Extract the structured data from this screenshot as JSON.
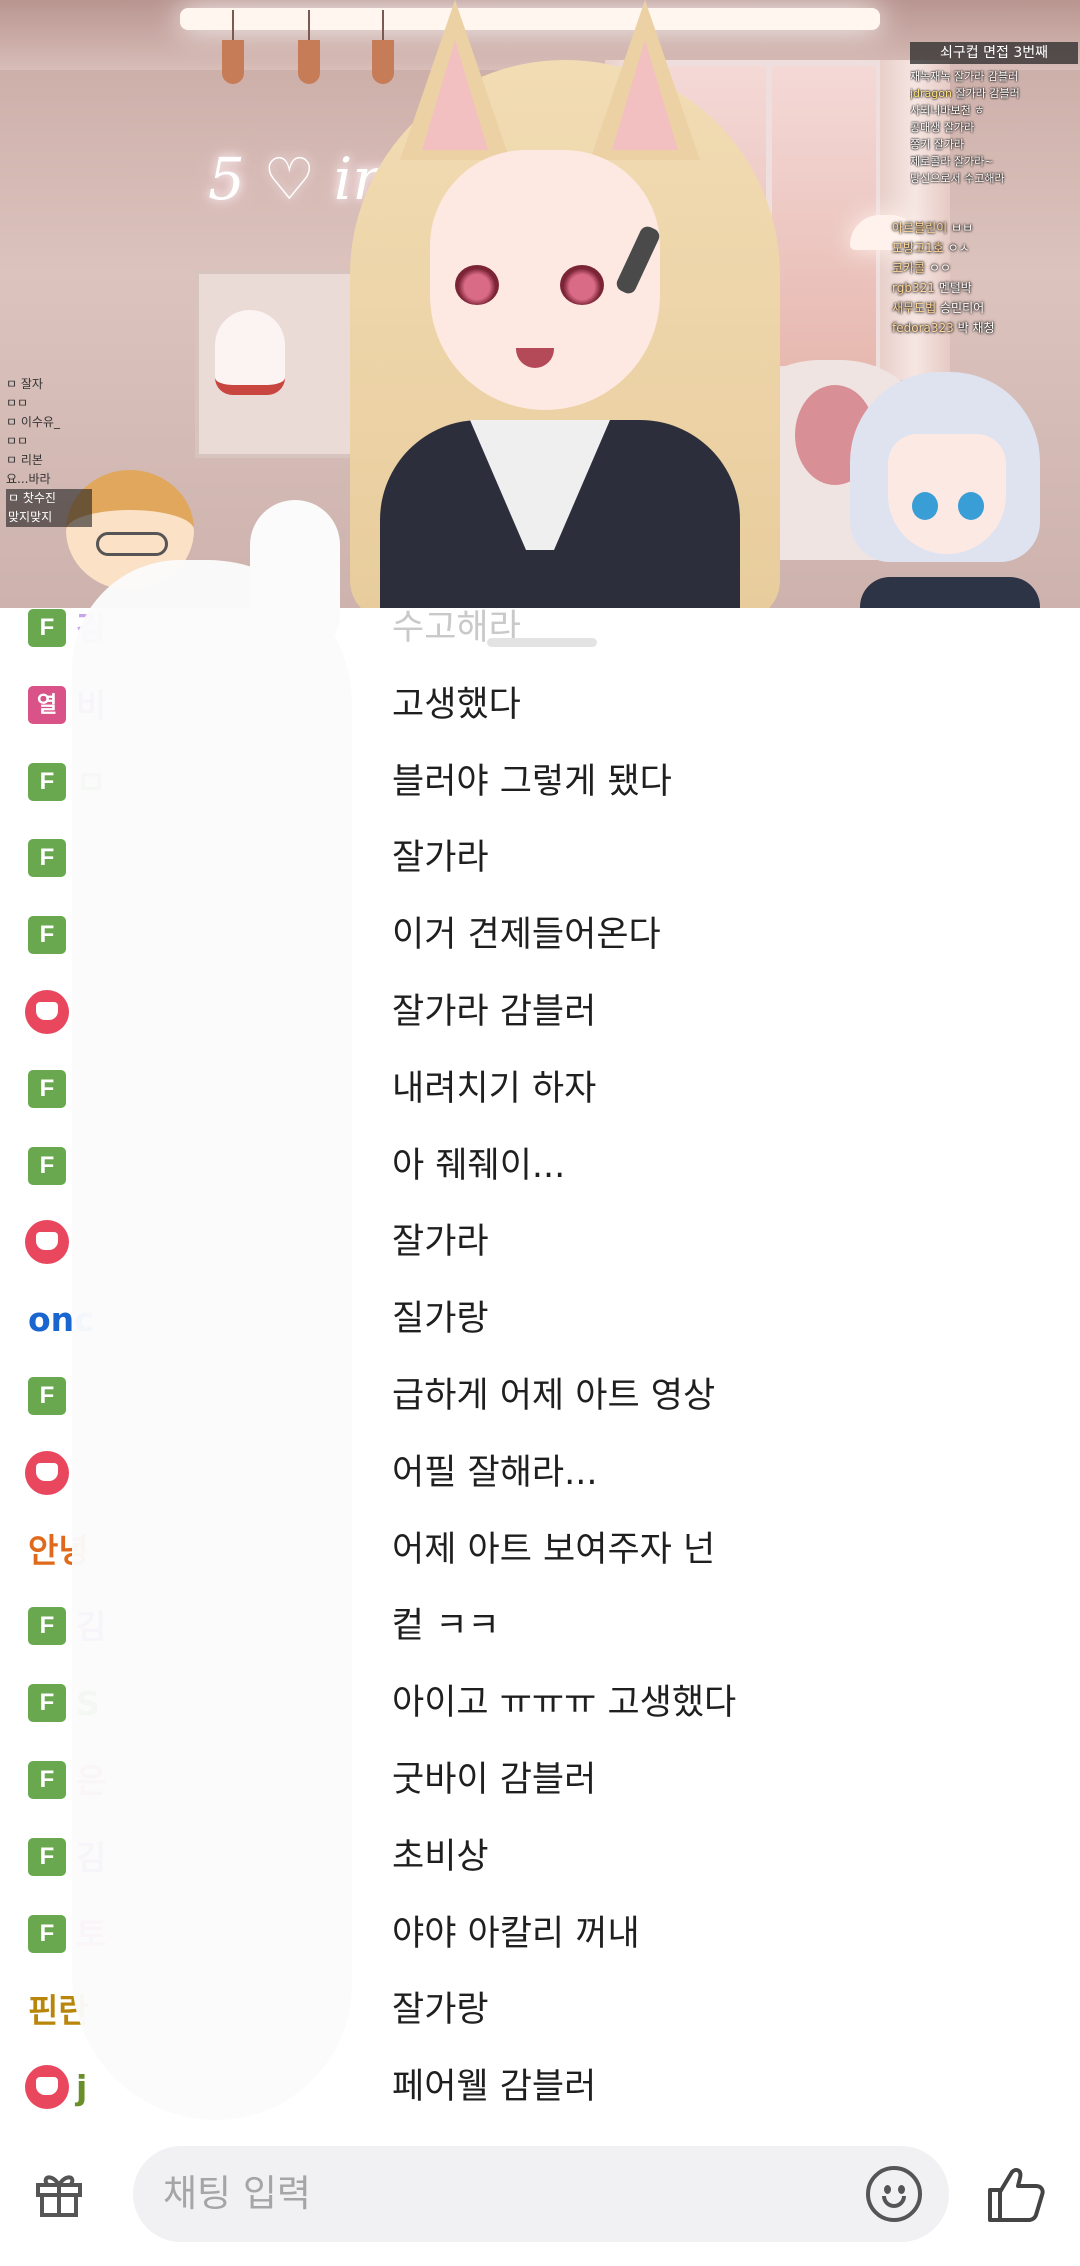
{
  "stream": {
    "title": "쇠구컵 면접 3번째",
    "overlay_chat_right": [
      {
        "name": "",
        "text": "재녹재녹 잘가라 감블러"
      },
      {
        "name": "jdragon",
        "text": "잘가라 감블러"
      },
      {
        "name": "",
        "text": "사되니바보천 ㅎ"
      },
      {
        "name": "",
        "text": "공대생 잘가라"
      },
      {
        "name": "",
        "text": "쫑키 잘가라"
      },
      {
        "name": "",
        "text": "제로콜라 잘가라~"
      },
      {
        "name": "",
        "text": "당신으로서 수고해라"
      }
    ],
    "overlay_chat_right2": [
      {
        "name": "아르블린이",
        "text": "ㅂㅂ"
      },
      {
        "name": "모방고1호",
        "text": "ㅇㅅ"
      },
      {
        "name": "코카콜",
        "text": "ㅇㅇ"
      },
      {
        "name": "rgb321",
        "text": "멘털박"
      },
      {
        "name": "새무도법",
        "text": "승민티어"
      },
      {
        "name": "fedora323",
        "text": "박 채청"
      }
    ],
    "overlay_chat_left": [
      "ㅁ 잘자",
      "ㅁㅁ",
      "ㅁ 이수유_",
      "ㅁㅁ",
      "ㅁ 리본",
      "요...바라",
      "ㅁ 찻수진",
      "맞지맞지"
    ],
    "neon_sign": "5 ♡ in"
  },
  "chat": {
    "messages": [
      {
        "badge": "F",
        "badge_type": "f",
        "nick": "김",
        "nick_color": "#c5a6e8",
        "text": "수고해라",
        "faded": true
      },
      {
        "badge": "열",
        "badge_type": "yeol",
        "nick": "비",
        "nick_color": "#8e44ad",
        "text": "고생했다",
        "faded": false
      },
      {
        "badge": "F",
        "badge_type": "f",
        "nick": "ㅁ",
        "nick_color": "#6aa84f",
        "text": "블러야 그렇게 됐다",
        "faded": false
      },
      {
        "badge": "F",
        "badge_type": "f",
        "nick": "",
        "nick_color": "#333333",
        "text": "잘가라",
        "faded": false
      },
      {
        "badge": "F",
        "badge_type": "f",
        "nick": "",
        "nick_color": "#333333",
        "text": "이거 견제들어온다",
        "faded": false
      },
      {
        "badge": "",
        "badge_type": "cup",
        "nick": "",
        "nick_color": "#333333",
        "text": "잘가라 감블러",
        "faded": false
      },
      {
        "badge": "F",
        "badge_type": "f",
        "nick": "",
        "nick_color": "#333333",
        "text": "내려치기 하자",
        "faded": false
      },
      {
        "badge": "F",
        "badge_type": "f",
        "nick": "",
        "nick_color": "#333333",
        "text": "아 줴줴이...",
        "faded": false
      },
      {
        "badge": "",
        "badge_type": "cup",
        "nick": "",
        "nick_color": "#333333",
        "text": "잘가라",
        "faded": false
      },
      {
        "badge": "",
        "badge_type": "none",
        "nick": "onc",
        "nick_color": "#1a66d1",
        "text": "질가랑",
        "faded": false
      },
      {
        "badge": "F",
        "badge_type": "f",
        "nick": "",
        "nick_color": "#333333",
        "text": "급하게 어제 아트 영상",
        "faded": false
      },
      {
        "badge": "",
        "badge_type": "cup",
        "nick": "",
        "nick_color": "#333333",
        "text": "어필 잘해라...",
        "faded": false
      },
      {
        "badge": "",
        "badge_type": "none",
        "nick": "안녕",
        "nick_color": "#e06a1b",
        "text": "어제 아트 보여주자 넌",
        "faded": false
      },
      {
        "badge": "F",
        "badge_type": "f",
        "nick": "김",
        "nick_color": "#7b3fb5",
        "text": "컽 ㅋㅋ",
        "faded": false
      },
      {
        "badge": "F",
        "badge_type": "f",
        "nick": "S",
        "nick_color": "#2e8b2e",
        "text": "아이고 ㅠㅠㅠ 고생했다",
        "faded": false
      },
      {
        "badge": "F",
        "badge_type": "f",
        "nick": "은",
        "nick_color": "#d23b5a",
        "text": "굿바이 감블러",
        "faded": false
      },
      {
        "badge": "F",
        "badge_type": "f",
        "nick": "김",
        "nick_color": "#7b3fb5",
        "text": "초비상",
        "faded": false
      },
      {
        "badge": "F",
        "badge_type": "f",
        "nick": "토",
        "nick_color": "#c63fa8",
        "text": "야야 아칼리 꺼내",
        "faded": false
      },
      {
        "badge": "",
        "badge_type": "none",
        "nick": "핀란",
        "nick_color": "#b8860b",
        "text": "잘가랑",
        "faded": false
      },
      {
        "badge": "",
        "badge_type": "cup",
        "nick": "j",
        "nick_color": "#6a8f2a",
        "text": "페어웰 감블러",
        "faded": false
      }
    ]
  },
  "bottom_bar": {
    "input_placeholder": "채팅 입력",
    "gift_icon": "gift-icon",
    "emoji_icon": "emoji-icon",
    "like_icon": "thumbs-up-icon"
  }
}
